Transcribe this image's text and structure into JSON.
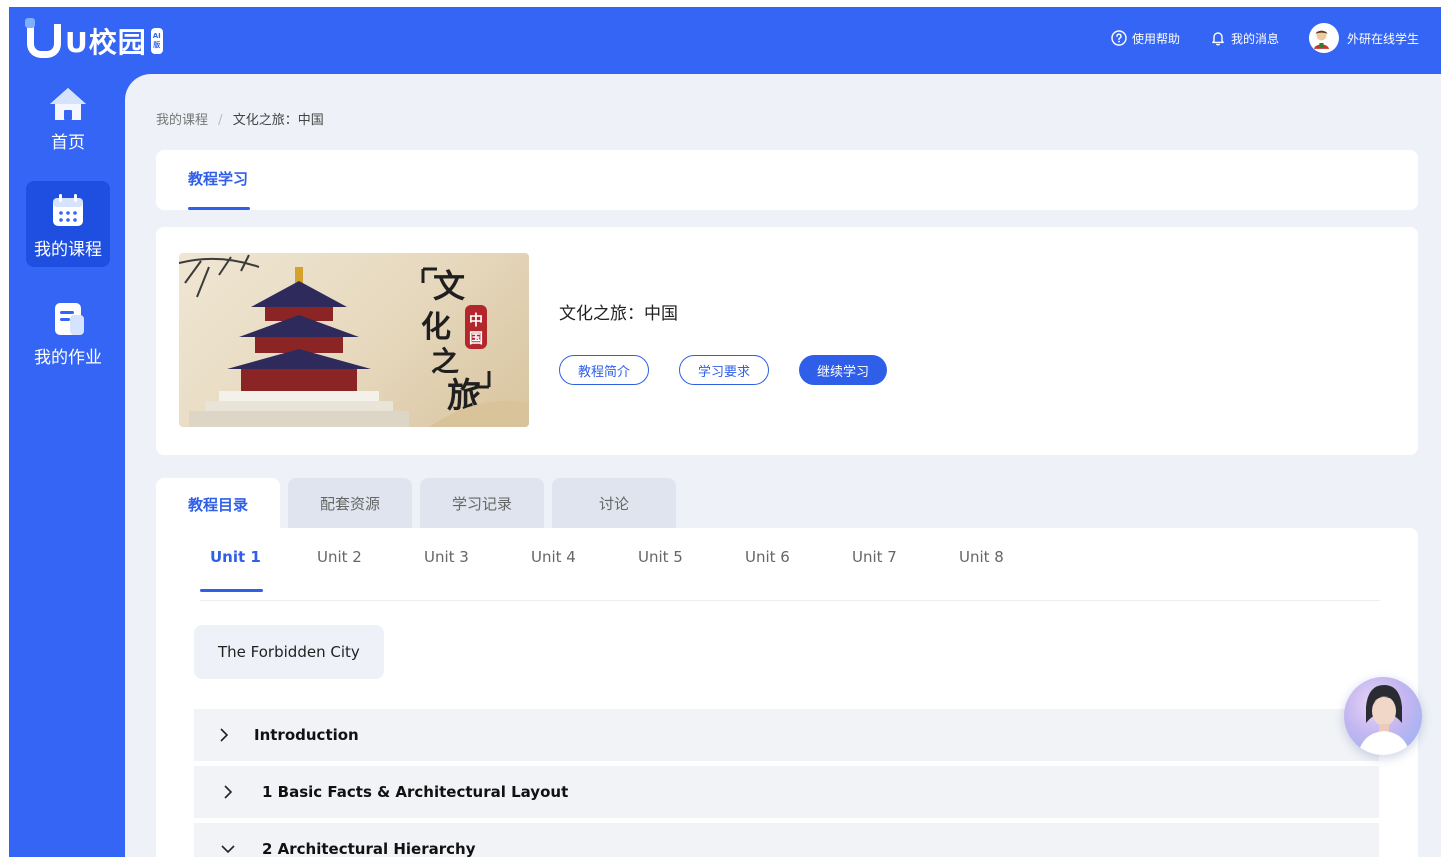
{
  "header": {
    "logo_text": "U校园",
    "logo_badge": "AI版",
    "help_label": "使用帮助",
    "messages_label": "我的消息",
    "user_name": "外研在线学生"
  },
  "sidebar": {
    "items": [
      {
        "label": "首页",
        "icon": "home-icon"
      },
      {
        "label": "我的课程",
        "icon": "calendar-icon",
        "active": true
      },
      {
        "label": "我的作业",
        "icon": "document-icon"
      }
    ]
  },
  "breadcrumb": {
    "root": "我的课程",
    "separator": "/",
    "current": "文化之旅：中国"
  },
  "page_tab": {
    "label": "教程学习"
  },
  "course": {
    "title": "文化之旅：中国",
    "banner_text": "文化之旅",
    "banner_stamp": "中国",
    "buttons": {
      "intro": "教程简介",
      "requirements": "学习要求",
      "continue": "继续学习"
    }
  },
  "section_tabs": [
    {
      "label": "教程目录",
      "active": true
    },
    {
      "label": "配套资源"
    },
    {
      "label": "学习记录"
    },
    {
      "label": "讨论"
    }
  ],
  "units": [
    "Unit 1",
    "Unit 2",
    "Unit 3",
    "Unit 4",
    "Unit 5",
    "Unit 6",
    "Unit 7",
    "Unit 8"
  ],
  "active_unit": "Unit 1",
  "unit_title": "The Forbidden City",
  "outline": [
    {
      "label": "Introduction",
      "expanded": false
    },
    {
      "label": "1 Basic Facts & Architectural Layout",
      "expanded": false
    },
    {
      "label": "2 Architectural Hierarchy",
      "expanded": true
    }
  ],
  "colors": {
    "primary": "#3565f5",
    "accent": "#2f5fe8",
    "background": "#eef1f7"
  }
}
